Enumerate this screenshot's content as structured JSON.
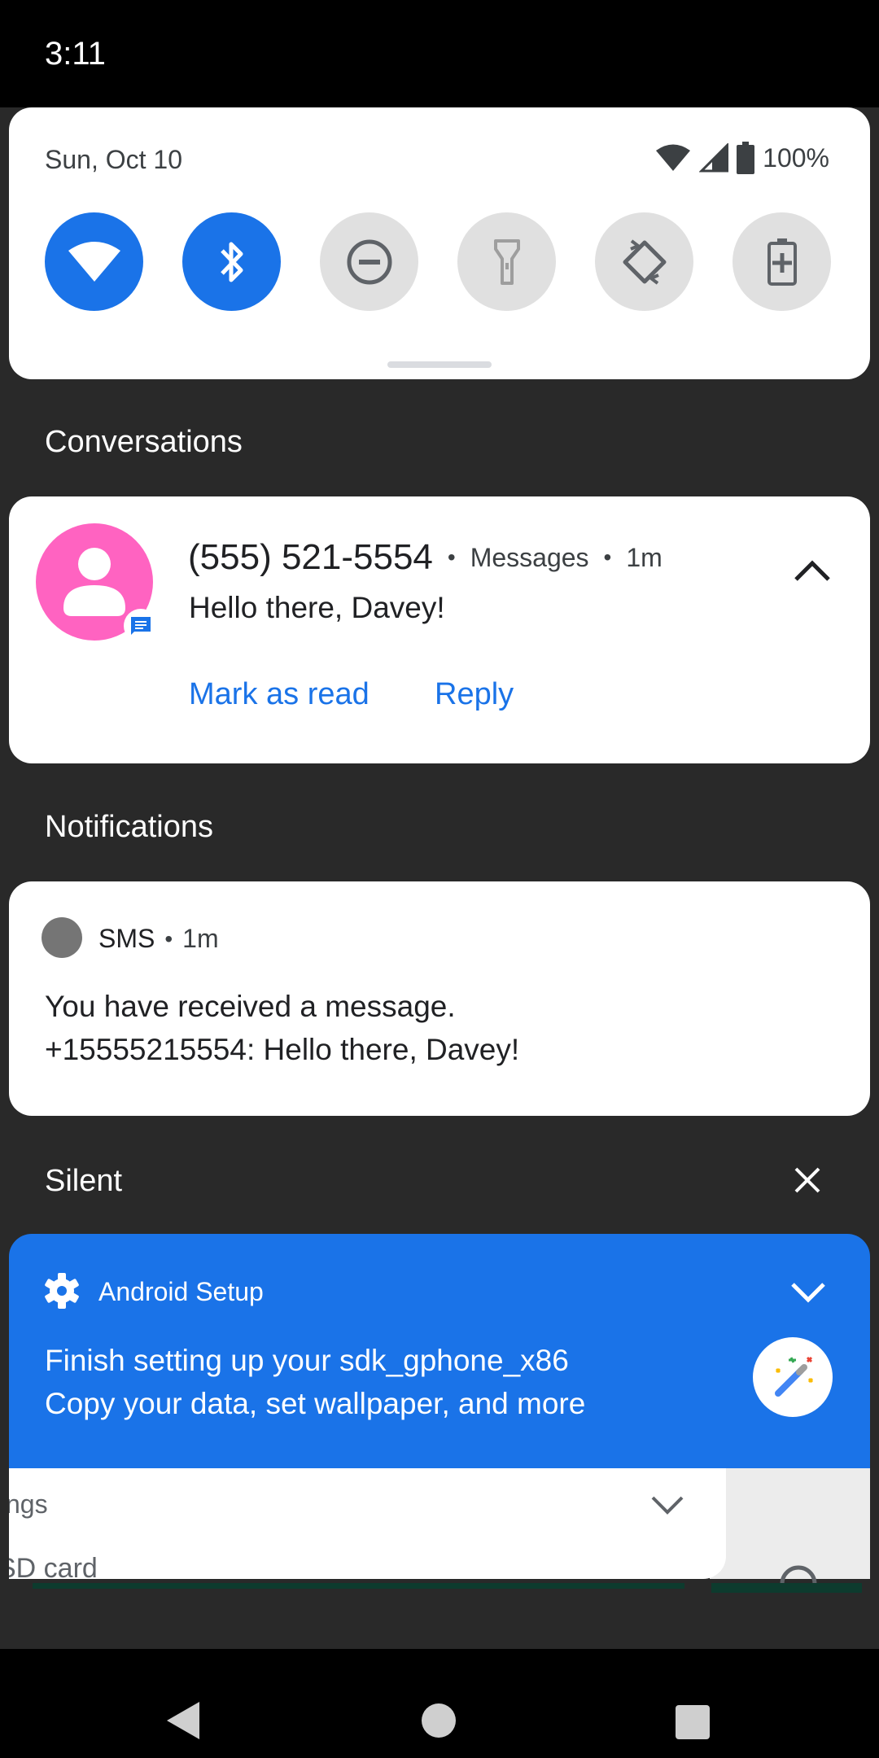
{
  "status_bar": {
    "time": "3:11"
  },
  "quick_settings": {
    "date": "Sun, Oct 10",
    "battery_percent": "100%",
    "tiles": [
      {
        "icon": "wifi-icon",
        "active": true
      },
      {
        "icon": "bluetooth-icon",
        "active": true
      },
      {
        "icon": "do-not-disturb-icon",
        "active": false
      },
      {
        "icon": "flashlight-icon",
        "active": false
      },
      {
        "icon": "auto-rotate-icon",
        "active": false
      },
      {
        "icon": "battery-saver-icon",
        "active": false
      }
    ]
  },
  "sections": {
    "conversations": "Conversations",
    "notifications": "Notifications",
    "silent": "Silent"
  },
  "conversation": {
    "sender": "(555) 521-5554",
    "app": "Messages",
    "time": "1m",
    "message": "Hello there, Davey!",
    "actions": {
      "mark_read": "Mark as read",
      "reply": "Reply"
    }
  },
  "sms_notification": {
    "app": "SMS",
    "time": "1m",
    "line1": "You have received a message.",
    "line2": "+15555215554: Hello there, Davey!"
  },
  "setup_notification": {
    "app": "Android Setup",
    "line1": "Finish setting up your sdk_gphone_x86",
    "line2": "Copy your data, set wallpaper, and more"
  },
  "stacked_notification": {
    "line1": "ngs",
    "line2": "SD card"
  },
  "colors": {
    "accent": "#1a73e8",
    "background": "#292929",
    "avatar": "#ff63c1"
  }
}
